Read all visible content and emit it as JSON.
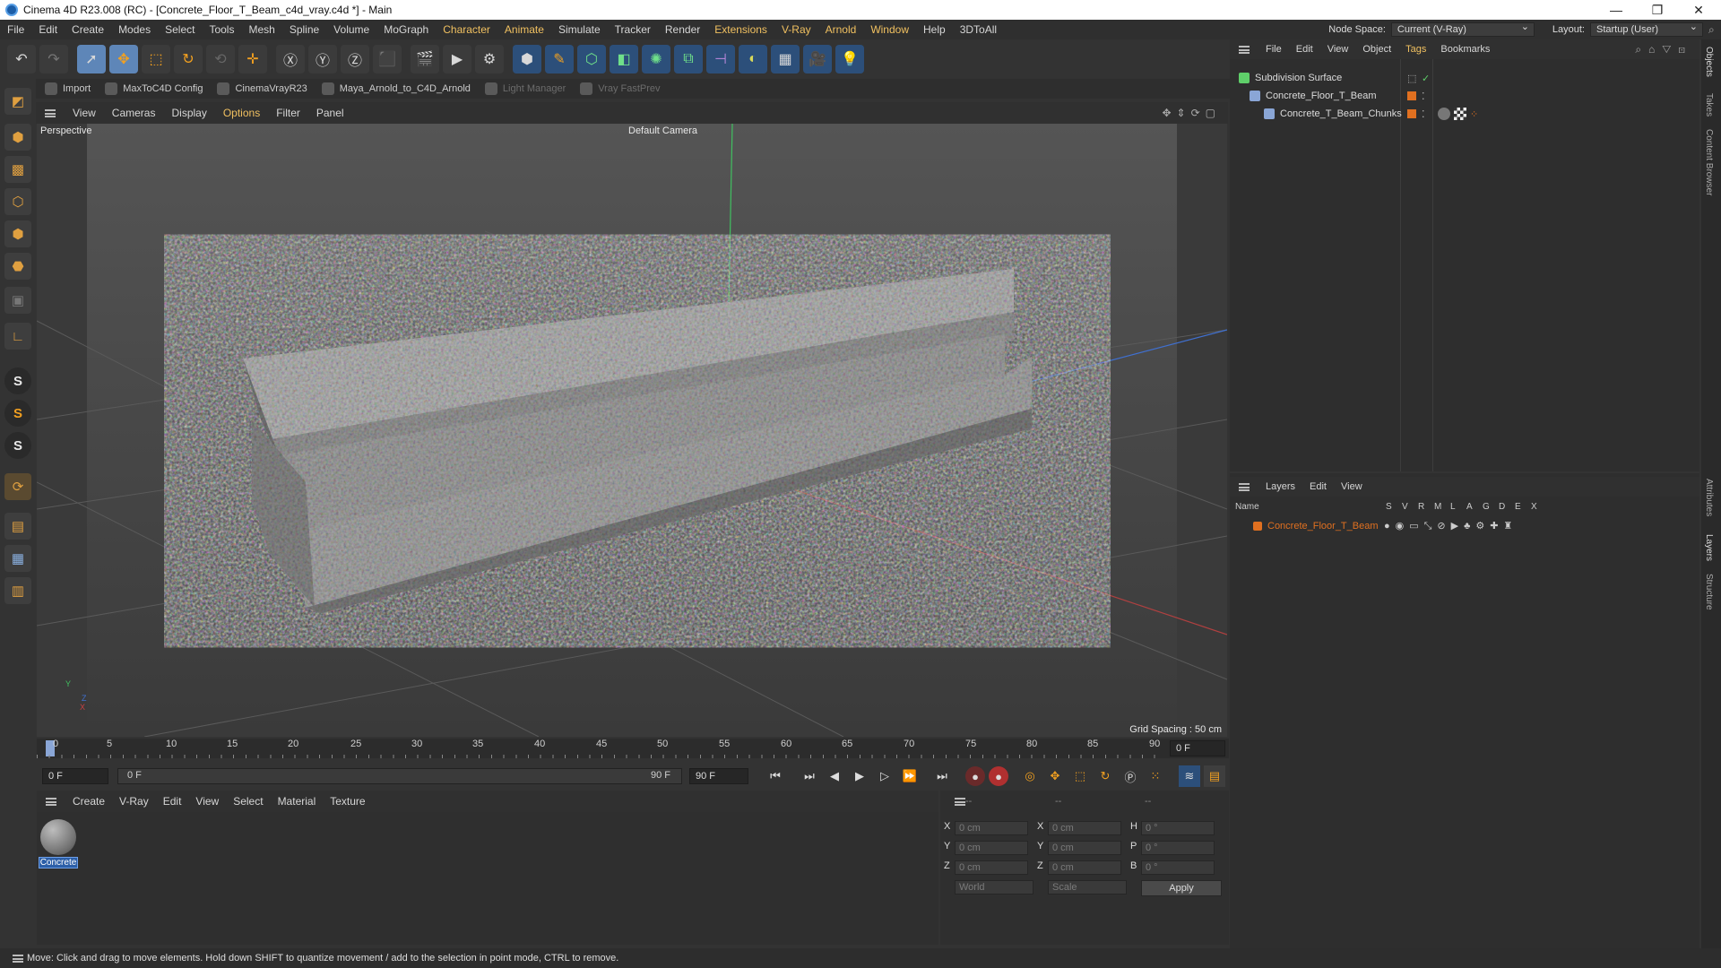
{
  "window": {
    "title": "Cinema 4D R23.008 (RC) - [Concrete_Floor_T_Beam_c4d_vray.c4d *] - Main",
    "controls": [
      "—",
      "❐",
      "✕"
    ]
  },
  "menubar": {
    "items": [
      "File",
      "Edit",
      "Create",
      "Modes",
      "Select",
      "Tools",
      "Mesh",
      "Spline",
      "Volume",
      "MoGraph",
      "Character",
      "Animate",
      "Simulate",
      "Tracker",
      "Render",
      "Extensions",
      "V-Ray",
      "Arnold",
      "Window",
      "Help",
      "3DToAll"
    ],
    "highlighted": [
      "Character",
      "Animate",
      "Extensions",
      "V-Ray",
      "Arnold",
      "Window"
    ],
    "node_space_label": "Node Space:",
    "node_space_value": "Current (V-Ray)",
    "layout_label": "Layout:",
    "layout_value": "Startup (User)"
  },
  "pluginbar": {
    "items": [
      "Import",
      "MaxToC4D Config",
      "CinemaVrayR23",
      "Maya_Arnold_to_C4D_Arnold",
      "Light Manager",
      "Vray FastPrev"
    ]
  },
  "viewport": {
    "menu": [
      "View",
      "Cameras",
      "Display",
      "Options",
      "Filter",
      "Panel"
    ],
    "menu_highlight": "Options",
    "projection": "Perspective",
    "camera": "Default Camera",
    "grid_spacing": "Grid Spacing : 50 cm",
    "axis_labels": {
      "y": "Y",
      "z": "Z",
      "x": "X"
    }
  },
  "timeline": {
    "ticks": [
      "0",
      "5",
      "10",
      "15",
      "20",
      "25",
      "30",
      "35",
      "40",
      "45",
      "50",
      "55",
      "60",
      "65",
      "70",
      "75",
      "80",
      "85",
      "90"
    ],
    "current_frame": "0 F"
  },
  "transport": {
    "start": "0 F",
    "range_start": "0 F",
    "range_end": "90 F",
    "end": "90 F"
  },
  "material_manager": {
    "menu": [
      "Create",
      "V-Ray",
      "Edit",
      "View",
      "Select",
      "Material",
      "Texture"
    ],
    "materials": [
      {
        "name": "Concrete"
      }
    ]
  },
  "coordinates": {
    "header": [
      "--",
      "--",
      "--"
    ],
    "rows": [
      {
        "l1": "X",
        "v1": "0 cm",
        "l2": "X",
        "v2": "0 cm",
        "l3": "H",
        "v3": "0 °"
      },
      {
        "l1": "Y",
        "v1": "0 cm",
        "l2": "Y",
        "v2": "0 cm",
        "l3": "P",
        "v3": "0 °"
      },
      {
        "l1": "Z",
        "v1": "0 cm",
        "l2": "Z",
        "v2": "0 cm",
        "l3": "B",
        "v3": "0 °"
      }
    ],
    "space": "World",
    "mode": "Scale",
    "apply": "Apply"
  },
  "object_manager": {
    "menu": [
      "File",
      "Edit",
      "View",
      "Object",
      "Tags",
      "Bookmarks"
    ],
    "menu_highlight": "Tags",
    "objects": [
      "Subdivision Surface",
      "Concrete_Floor_T_Beam",
      "Concrete_T_Beam_Chunks"
    ]
  },
  "layer_manager": {
    "menu": [
      "Layers",
      "Edit",
      "View"
    ],
    "columns": [
      "Name",
      "S",
      "V",
      "R",
      "M",
      "L",
      "A",
      "G",
      "D",
      "E",
      "X"
    ],
    "layers": [
      {
        "name": "Concrete_Floor_T_Beam",
        "color": "#e07020"
      }
    ]
  },
  "side_tabs": [
    "Objects",
    "Takes",
    "Content Browser",
    "Attributes",
    "Layers",
    "Structure"
  ],
  "status": "Move: Click and drag to move elements. Hold down SHIFT to quantize movement / add to the selection in point mode, CTRL to remove.",
  "colors": {
    "accent_orange": "#e07020",
    "highlight_menu": "#f0c060",
    "axis_x": "#c84040",
    "axis_y": "#40c060",
    "axis_z": "#4070d0"
  }
}
